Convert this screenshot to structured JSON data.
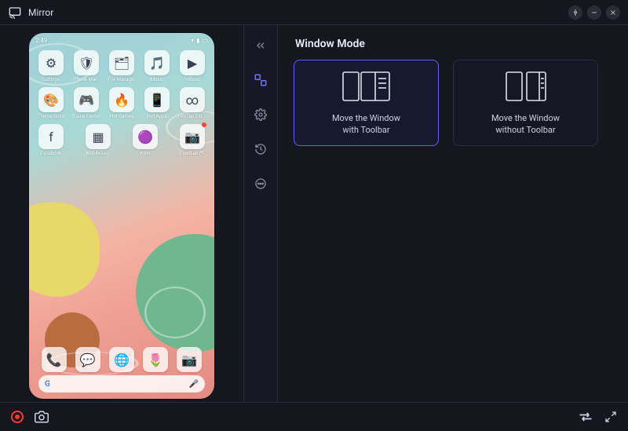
{
  "titlebar": {
    "title": "Mirror"
  },
  "phone": {
    "clock": "2:49",
    "status_icons": [
      "bluetooth",
      "wifi",
      "signal",
      "battery"
    ],
    "rows": [
      [
        {
          "icon": "⚙",
          "label": "Settings"
        },
        {
          "icon": "🛡",
          "label": "Phone Man."
        },
        {
          "icon": "🗂",
          "label": "File Manager"
        },
        {
          "icon": "🎵",
          "label": "Music"
        },
        {
          "icon": "▶",
          "label": "Videos"
        }
      ],
      [
        {
          "icon": "🎨",
          "label": "Theme Store"
        },
        {
          "icon": "🎮",
          "label": "Game Center"
        },
        {
          "icon": "🔥",
          "label": "Hot Games"
        },
        {
          "icon": "📱",
          "label": "Hot Apps"
        },
        {
          "icon": "∞",
          "label": "HeyTap Cloud"
        }
      ],
      [
        {
          "icon": "f",
          "label": "Facebook"
        },
        {
          "icon": "▦",
          "label": "Mobile Leg."
        },
        {
          "icon": "🟣",
          "label": "Kyun"
        },
        {
          "icon": "📷",
          "label": "FoodLab Pl.",
          "dot": true
        }
      ]
    ],
    "dock": [
      {
        "icon": "📞"
      },
      {
        "icon": "💬"
      },
      {
        "icon": "🌐"
      },
      {
        "icon": "🌷"
      },
      {
        "icon": "📷"
      }
    ],
    "search_brand": "G",
    "search_placeholder": ""
  },
  "sidetool": {
    "items": [
      {
        "name": "collapse",
        "active": false
      },
      {
        "name": "window-mode",
        "active": true
      },
      {
        "name": "settings",
        "active": false
      },
      {
        "name": "history",
        "active": false
      },
      {
        "name": "more",
        "active": false
      }
    ]
  },
  "right": {
    "title": "Window Mode",
    "cards": [
      {
        "label_line1": "Move the Window",
        "label_line2": "with Toolbar",
        "selected": true
      },
      {
        "label_line1": "Move the Window",
        "label_line2": "without Toolbar",
        "selected": false
      }
    ]
  },
  "bottombar": {
    "left": [
      "record",
      "screenshot"
    ],
    "right": [
      "transfer",
      "fullscreen"
    ]
  },
  "colors": {
    "accent": "#5964ff",
    "record": "#ff3b30"
  }
}
